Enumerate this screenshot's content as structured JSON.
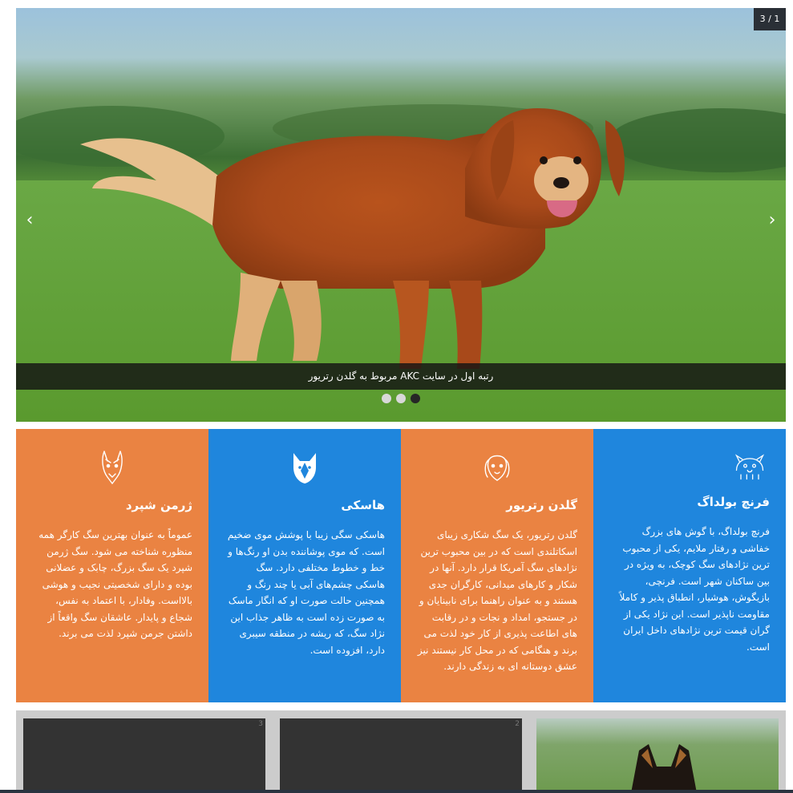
{
  "slider": {
    "counter": "3 / 1",
    "caption": "رتبه اول در سایت AKC مربوط به گلدن رتریور",
    "prev_icon": "chevron-left-icon",
    "next_icon": "chevron-right-icon",
    "dots": 3,
    "active_dot": 3
  },
  "cards": [
    {
      "title": "فرنچ بولداگ",
      "icon": "bulldog-icon",
      "color": "#1f86dd",
      "text": "فرنچ بولداگ، با گوش های بزرگ خفاشی و رفتار ملایم، یکی از محبوب ترین نژادهای سگ کوچک، به ویژه در بین ساکنان شهر است. فرنچی، بازیگوش، هوشیار، انطباق پذیر و کاملاً مقاومت ناپذیر است. این نژاد یکی از گران قیمت ترین نژادهای داخل ایران است."
    },
    {
      "title": "گلدن رتریور",
      "icon": "golden-retriever-icon",
      "color": "#ea8342",
      "text": "گلدن رتریور، یک سگ شکاری زیبای اسکاتلندی است که در بین محبوب ترین نژادهای سگ آمریکا قرار دارد. آنها در شکار و کارهای میدانی، کارگران جدی هستند و به عنوان راهنما برای نابینایان و در جستجو، امداد و نجات و در رقابت های اطاعت پذیری از کار خود لذت می برند و هنگامی که در محل کار نیستند نیز عشق دوستانه ای به زندگی دارند."
    },
    {
      "title": "هاسکی",
      "icon": "husky-icon",
      "color": "#1f86dd",
      "text": "هاسکی سگی زیبا با پوشش موی ضخیم است. که موی پوشاننده بدن او رنگ‌ها و خط و خطوط مختلفی دارد. سگ هاسکی چشم‌های آبی یا چند رنگ و همچنین حالت صورت او که انگار ماسک به صورت زده است به ظاهر جذاب این نژاد سگ، که ریشه در منطقه سیبری دارد، افزوده است."
    },
    {
      "title": "ژرمن شپرد",
      "icon": "german-shepherd-icon",
      "color": "#ea8342",
      "text": "عموماً به عنوان بهترین سگ کارگر همه منظوره شناخته می شود. سگ ژرمن شپرد یک سگ بزرگ، چابک و عضلانی بوده و دارای شخصیتی نجیب و هوشی بالااست. وفادار، با اعتماد به نفس، شجاع و پایدار. عاشقان سگ واقعاً از داشتن جرمن شپرد لذت می برند."
    }
  ],
  "thumbs": [
    "3",
    "2",
    ""
  ]
}
